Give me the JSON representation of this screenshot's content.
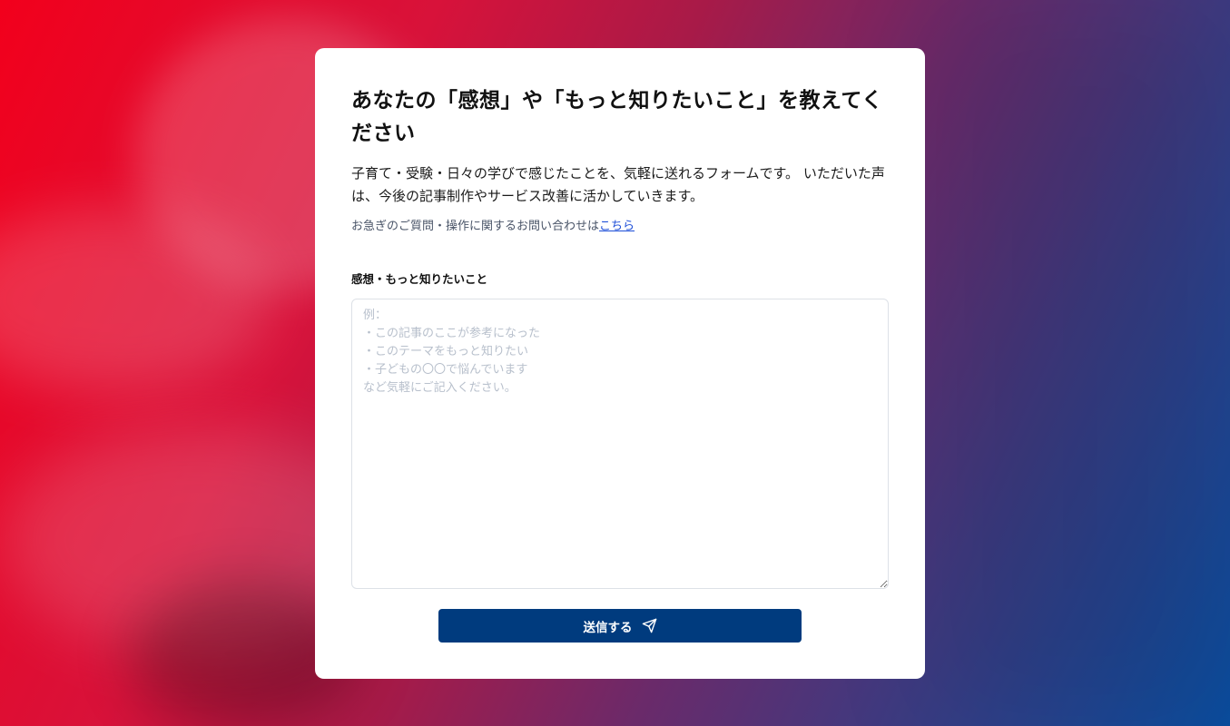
{
  "page": {
    "title_line": "あなたの「感想」や「もっと知りたいこと」を教えてください",
    "description": "子育て・受験・日々の学びで感じたことを、気軽に送れるフォームです。 いただいた声は、今後の記事制作やサービス改善に活かしていきます。",
    "note_prefix": "お急ぎのご質問・操作に関するお問い合わせは",
    "note_link": "こちら"
  },
  "form": {
    "field_label": "感想・もっと知りたいこと",
    "placeholder": "例：\n・この記事のここが参考になった\n・このテーマをもっと知りたい\n・子どもの〇〇で悩んでいます\nなど気軽にご記入ください。",
    "value": "",
    "submit_label": "送信する",
    "submit_icon": "send-icon"
  },
  "colors": {
    "button": "#003b7e",
    "link": "#1d4ed8",
    "gradient_start": "#f2001c",
    "gradient_end": "#0a4d9e"
  }
}
